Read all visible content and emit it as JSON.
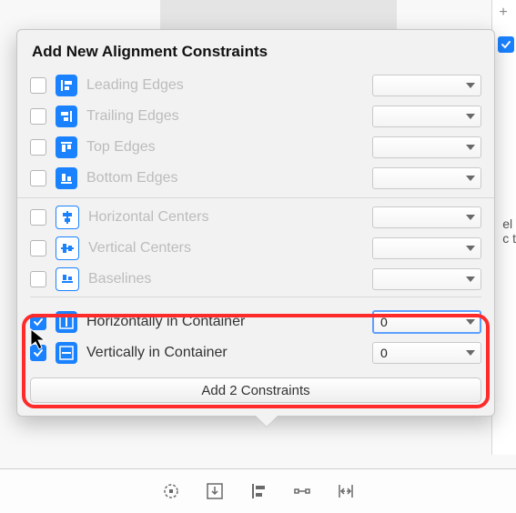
{
  "popover": {
    "title": "Add New Alignment Constraints",
    "group1": [
      {
        "icon": "align-leading-icon",
        "label": "Leading Edges",
        "value": ""
      },
      {
        "icon": "align-trailing-icon",
        "label": "Trailing Edges",
        "value": ""
      },
      {
        "icon": "align-top-icon",
        "label": "Top Edges",
        "value": ""
      },
      {
        "icon": "align-bottom-icon",
        "label": "Bottom Edges",
        "value": ""
      }
    ],
    "group2": [
      {
        "icon": "align-hcenters-icon",
        "label": "Horizontal Centers",
        "value": ""
      },
      {
        "icon": "align-vcenters-icon",
        "label": "Vertical Centers",
        "value": ""
      },
      {
        "icon": "align-baselines-icon",
        "label": "Baselines",
        "value": ""
      }
    ],
    "group3": [
      {
        "icon": "center-horizontally-icon",
        "label": "Horizontally in Container",
        "value": "0",
        "checked": true,
        "focused": true
      },
      {
        "icon": "center-vertically-icon",
        "label": "Vertically in Container",
        "value": "0",
        "checked": true,
        "focused": false
      }
    ],
    "add_button_label": "Add 2 Constraints"
  },
  "background": {
    "plus_label": "+",
    "right_text_1": "el",
    "right_text_2": "c t"
  }
}
